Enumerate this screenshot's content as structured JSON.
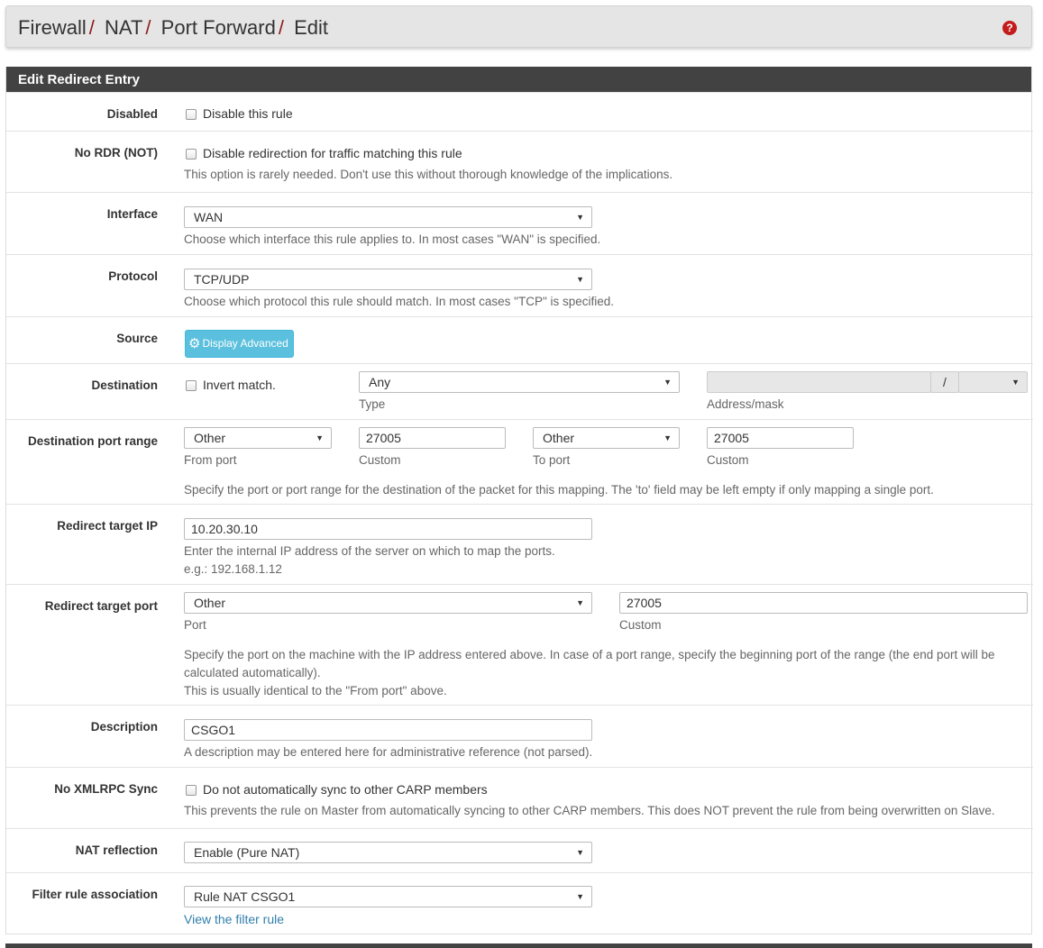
{
  "breadcrumb": [
    "Firewall",
    "NAT",
    "Port Forward",
    "Edit"
  ],
  "breadcrumb_separator": "/",
  "help_icon": "question-circle-icon",
  "panel_title": "Edit Redirect Entry",
  "disabled": {
    "label": "Disabled",
    "checkbox_text": "Disable this rule",
    "checked": false
  },
  "nordr": {
    "label": "No RDR (NOT)",
    "checkbox_text": "Disable redirection for traffic matching this rule",
    "help": "This option is rarely needed. Don't use this without thorough knowledge of the implications.",
    "checked": false
  },
  "interface": {
    "label": "Interface",
    "value": "WAN",
    "help": "Choose which interface this rule applies to. In most cases \"WAN\" is specified."
  },
  "protocol": {
    "label": "Protocol",
    "value": "TCP/UDP",
    "help": "Choose which protocol this rule should match. In most cases \"TCP\" is specified."
  },
  "source": {
    "label": "Source",
    "button": "Display Advanced",
    "button_icon": "gear-icon"
  },
  "destination": {
    "label": "Destination",
    "invert_text": "Invert match.",
    "type_value": "Any",
    "type_label": "Type",
    "address_label": "Address/mask",
    "mask_separator": "/"
  },
  "dest_port_range": {
    "label": "Destination port range",
    "from_value": "Other",
    "from_label": "From port",
    "from_custom": "27005",
    "custom_label": "Custom",
    "to_value": "Other",
    "to_label": "To port",
    "to_custom": "27005",
    "help": "Specify the port or port range for the destination of the packet for this mapping. The 'to' field may be left empty if only mapping a single port."
  },
  "redirect_ip": {
    "label": "Redirect target IP",
    "value": "10.20.30.10",
    "help1": "Enter the internal IP address of the server on which to map the ports.",
    "help2": "e.g.: 192.168.1.12"
  },
  "redirect_port": {
    "label": "Redirect target port",
    "value": "Other",
    "port_label": "Port",
    "custom_value": "27005",
    "custom_label": "Custom",
    "help1": "Specify the port on the machine with the IP address entered above. In case of a port range, specify the beginning port of the range (the end port will be",
    "help2": "calculated automatically).",
    "help3": "This is usually identical to the \"From port\" above."
  },
  "description": {
    "label": "Description",
    "value": "CSGO1",
    "help": "A description may be entered here for administrative reference (not parsed)."
  },
  "xmlrpc": {
    "label": "No XMLRPC Sync",
    "checkbox_text": "Do not automatically sync to other CARP members",
    "help": "This prevents the rule on Master from automatically syncing to other CARP members. This does NOT prevent the rule from being overwritten on Slave.",
    "checked": false
  },
  "nat_reflection": {
    "label": "NAT reflection",
    "value": "Enable (Pure NAT)"
  },
  "filter_rule": {
    "label": "Filter rule association",
    "value": "Rule NAT CSGO1",
    "link": "View the filter rule"
  },
  "colors": {
    "panel_heading": "#424242",
    "button_info": "#5bc0de",
    "link": "#317eac",
    "breadcrumb_sep": "#8e1b1b",
    "help_icon": "#c41c1c"
  }
}
